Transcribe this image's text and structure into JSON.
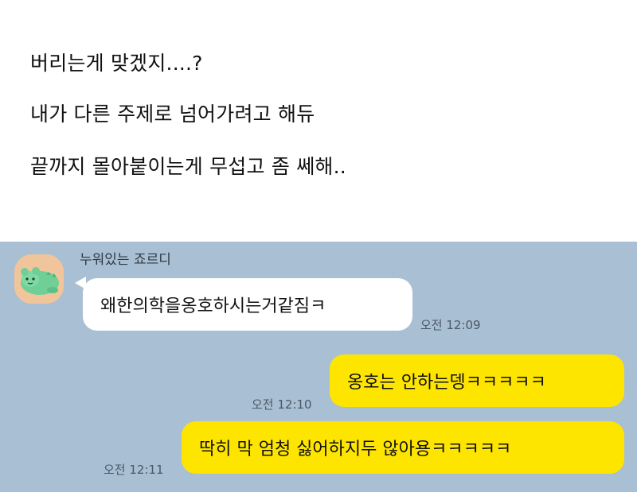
{
  "post": {
    "lines": [
      "버리는게 맞겠지....?",
      "내가 다른 주제로 넘어가려고 해듀",
      "끝까지 몰아붙이는게 무섭고 좀 쎄해.."
    ]
  },
  "chat": {
    "sender_name": "누워있는 죠르디",
    "avatar_icon": "jordy-lying-avatar-icon",
    "messages": [
      {
        "from": "other",
        "text": "왜한의학을옹호하시는거같짐ㅋ",
        "time": "오전 12:09"
      },
      {
        "from": "me",
        "text": "옹호는 안하는뎅ㅋㅋㅋㅋㅋ",
        "time": "오전 12:10"
      },
      {
        "from": "me",
        "text": "딱히 막 엄청 싫어하지두 않아용ㅋㅋㅋㅋㅋ",
        "time": "오전 12:11"
      }
    ],
    "colors": {
      "background": "#a9bfd3",
      "my_bubble": "#fee500",
      "other_bubble": "#ffffff"
    }
  }
}
